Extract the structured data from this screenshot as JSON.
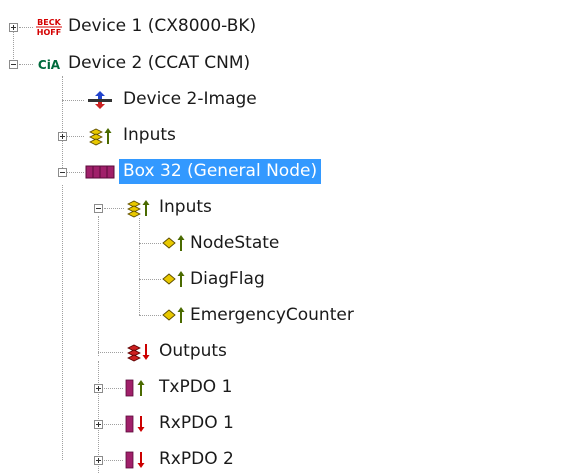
{
  "tree": {
    "device1": {
      "label": "Device 1 (CX8000-BK)",
      "icon": "beckhoff-logo-icon",
      "icon_text_top": "BECK",
      "icon_text_bottom": "HOFF",
      "expanded": false
    },
    "device2": {
      "label": "Device 2 (CCAT CNM)",
      "icon": "cia-logo-icon",
      "icon_text": "CiA",
      "expanded": true
    },
    "device2_image": {
      "label": "Device 2-Image",
      "icon": "image-icon"
    },
    "device2_inputs": {
      "label": "Inputs",
      "icon": "inputs-folder-icon",
      "expanded": false
    },
    "box32": {
      "label": "Box 32 (General Node)",
      "icon": "box-module-icon",
      "selected": true,
      "expanded": true
    },
    "box32_inputs": {
      "label": "Inputs",
      "icon": "inputs-folder-icon",
      "expanded": true
    },
    "nodestate": {
      "label": "NodeState",
      "icon": "input-variable-icon"
    },
    "diagflag": {
      "label": "DiagFlag",
      "icon": "input-variable-icon"
    },
    "emergencycounter": {
      "label": "EmergencyCounter",
      "icon": "input-variable-icon"
    },
    "outputs": {
      "label": "Outputs",
      "icon": "outputs-folder-icon"
    },
    "txpdo1": {
      "label": "TxPDO 1",
      "icon": "txpdo-icon",
      "expanded": false
    },
    "rxpdo1": {
      "label": "RxPDO 1",
      "icon": "rxpdo-icon",
      "expanded": false
    },
    "rxpdo2": {
      "label": "RxPDO 2",
      "icon": "rxpdo-icon",
      "expanded": false
    }
  },
  "colors": {
    "selection": "#3399ff",
    "beckhoff_red": "#d40000",
    "cia_green": "#006a3c",
    "input_arrow": "#4a6a00",
    "output_arrow": "#cc0000",
    "chip_yellow": "#e8c800",
    "module_purple": "#a0206a"
  }
}
